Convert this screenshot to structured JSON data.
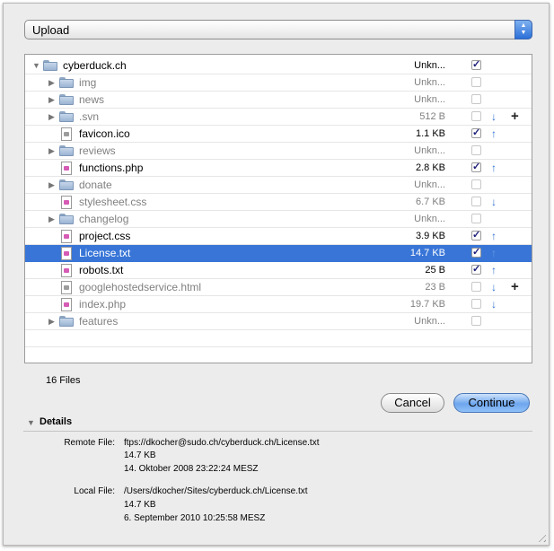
{
  "upload_popup": {
    "label": "Upload"
  },
  "files": [
    {
      "name": "cyberduck.ch",
      "size": "Unkn...",
      "kind": "folder",
      "level": 0,
      "expanded": true,
      "checked": true,
      "dim": false,
      "arrow": "",
      "plus": false,
      "selected": false
    },
    {
      "name": "img",
      "size": "Unkn...",
      "kind": "folder",
      "level": 1,
      "expanded": false,
      "checked": false,
      "dim": true,
      "arrow": "",
      "plus": false,
      "selected": false
    },
    {
      "name": "news",
      "size": "Unkn...",
      "kind": "folder",
      "level": 1,
      "expanded": false,
      "checked": false,
      "dim": true,
      "arrow": "",
      "plus": false,
      "selected": false
    },
    {
      "name": ".svn",
      "size": "512 B",
      "kind": "folder",
      "level": 1,
      "expanded": false,
      "checked": false,
      "dim": true,
      "arrow": "down",
      "plus": true,
      "selected": false
    },
    {
      "name": "favicon.ico",
      "size": "1.1 KB",
      "kind": "doc-plain",
      "level": 1,
      "expanded": null,
      "checked": true,
      "dim": false,
      "arrow": "up",
      "plus": false,
      "selected": false
    },
    {
      "name": "reviews",
      "size": "Unkn...",
      "kind": "folder",
      "level": 1,
      "expanded": false,
      "checked": false,
      "dim": true,
      "arrow": "",
      "plus": false,
      "selected": false
    },
    {
      "name": "functions.php",
      "size": "2.8 KB",
      "kind": "doc-web",
      "level": 1,
      "expanded": null,
      "checked": true,
      "dim": false,
      "arrow": "up",
      "plus": false,
      "selected": false
    },
    {
      "name": "donate",
      "size": "Unkn...",
      "kind": "folder",
      "level": 1,
      "expanded": false,
      "checked": false,
      "dim": true,
      "arrow": "",
      "plus": false,
      "selected": false
    },
    {
      "name": "stylesheet.css",
      "size": "6.7 KB",
      "kind": "doc-web",
      "level": 1,
      "expanded": null,
      "checked": false,
      "dim": true,
      "arrow": "down",
      "plus": false,
      "selected": false
    },
    {
      "name": "changelog",
      "size": "Unkn...",
      "kind": "folder",
      "level": 1,
      "expanded": false,
      "checked": false,
      "dim": true,
      "arrow": "",
      "plus": false,
      "selected": false
    },
    {
      "name": "project.css",
      "size": "3.9 KB",
      "kind": "doc-web",
      "level": 1,
      "expanded": null,
      "checked": true,
      "dim": false,
      "arrow": "up",
      "plus": false,
      "selected": false
    },
    {
      "name": "License.txt",
      "size": "14.7 KB",
      "kind": "doc-web",
      "level": 1,
      "expanded": null,
      "checked": true,
      "dim": false,
      "arrow": "up",
      "plus": false,
      "selected": true
    },
    {
      "name": "robots.txt",
      "size": "25 B",
      "kind": "doc-web",
      "level": 1,
      "expanded": null,
      "checked": true,
      "dim": false,
      "arrow": "up",
      "plus": false,
      "selected": false
    },
    {
      "name": "googlehostedservice.html",
      "size": "23 B",
      "kind": "doc-plain",
      "level": 1,
      "expanded": null,
      "checked": false,
      "dim": true,
      "arrow": "down",
      "plus": true,
      "selected": false
    },
    {
      "name": "index.php",
      "size": "19.7 KB",
      "kind": "doc-web",
      "level": 1,
      "expanded": null,
      "checked": false,
      "dim": true,
      "arrow": "down",
      "plus": false,
      "selected": false
    },
    {
      "name": "features",
      "size": "Unkn...",
      "kind": "folder",
      "level": 1,
      "expanded": false,
      "checked": false,
      "dim": true,
      "arrow": "",
      "plus": false,
      "selected": false
    }
  ],
  "file_count": "16 Files",
  "buttons": {
    "cancel": "Cancel",
    "continue": "Continue"
  },
  "details": {
    "title": "Details",
    "remote_label": "Remote File:",
    "remote_path": "ftps://dkocher@sudo.ch/cyberduck.ch/License.txt",
    "remote_size": "14.7 KB",
    "remote_date": "14. Oktober 2008 23:22:24 MESZ",
    "local_label": "Local File:",
    "local_path": "/Users/dkocher/Sites/cyberduck.ch/License.txt",
    "local_size": "14.7 KB",
    "local_date": "6. September 2010 10:25:58 MESZ"
  },
  "colors": {
    "selection": "#3875d7",
    "arrow": "#2e6fd0",
    "accent_button": "#6ea6ee"
  },
  "icons": {
    "up": "up-arrow-icon",
    "down": "down-arrow-icon",
    "plus": "plus-icon",
    "folder": "folder-icon",
    "document": "document-icon"
  }
}
